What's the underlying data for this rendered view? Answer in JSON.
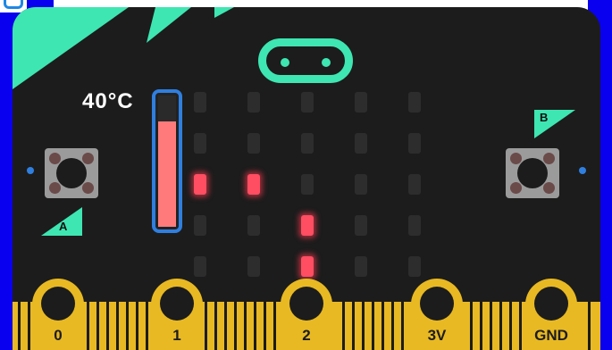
{
  "device": {
    "temperature_label": "40°C",
    "temperature_fraction": 0.8,
    "button_a_label": "A",
    "button_b_label": "B",
    "logo_icon": "microbit-logo-icon",
    "colors": {
      "board": "#1c1c1c",
      "accent": "#3ee6b1",
      "led_on": "#ff4d62",
      "led_off": "#2d2d2d",
      "gold": "#e8b923",
      "thermometer_border": "#2f7fe0",
      "thermometer_fill": "#ff7b7b"
    },
    "led_grid": [
      [
        0,
        0,
        0,
        0,
        0
      ],
      [
        0,
        0,
        0,
        0,
        0
      ],
      [
        1,
        1,
        0,
        0,
        0
      ],
      [
        0,
        0,
        1,
        0,
        0
      ],
      [
        0,
        0,
        1,
        0,
        0
      ]
    ],
    "pins": [
      {
        "label": "0"
      },
      {
        "label": "1"
      },
      {
        "label": "2"
      },
      {
        "label": "3V"
      },
      {
        "label": "GND"
      }
    ]
  }
}
